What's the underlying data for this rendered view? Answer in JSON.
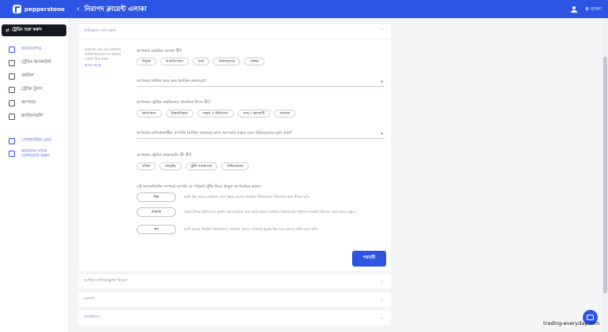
{
  "header": {
    "brand": "pepperstone",
    "back_icon": "chevron-left-icon",
    "title": "নিরাপদ ক্লায়েন্ট এলাকা",
    "language": "বাংলা"
  },
  "sidebar": {
    "start_trading": "ট্রেডিং শুরু করুন",
    "items": [
      {
        "label": "আবেদনপত্র",
        "icon": "document-icon",
        "active": true
      },
      {
        "label": "ট্রেডিং অ্যাকাউন্ট",
        "icon": "layers-icon"
      },
      {
        "label": "তহবিল",
        "icon": "wallet-icon"
      },
      {
        "label": "ট্রেডিং টুলস",
        "icon": "tools-icon"
      },
      {
        "label": "আপনার",
        "icon": "lock-icon"
      },
      {
        "label": "প্ল্যাটফর্মগুলি",
        "icon": "chart-icon"
      }
    ],
    "secondary": [
      {
        "label": "পেপারস্টোন হোম",
        "icon": "home-icon"
      },
      {
        "label": "আমাদের সাথে যোগাযোগ করুন",
        "icon": "phone-icon"
      }
    ]
  },
  "form": {
    "section_title": "অভিজ্ঞতা এবং জ্ঞান",
    "help_text": "আমাদের কেন এই তথ্যগুলি জানার প্রয়োজন তা জানতে এখানে ক্লিক করুন",
    "help_link": "আরও জানুন",
    "q_employment": "আপনার চাকরির অবস্থা কী?",
    "employment_options": [
      "নিযুক্ত",
      "স্ব-কর্মসংস্থান",
      "ছাত্র",
      "অবসরপ্রাপ্ত",
      "বেকার"
    ],
    "q_income": "আপনার বার্ষিক আয় কত (মার্কিন ডলারে)?",
    "q_funds_source": "আপনার ট্রেডিং তহবিলের প্রাথমিক উৎস কী?",
    "funds_options": [
      "কর্মসংস্থান",
      "উত্তরাধিকার",
      "সঞ্চয় ও বিনিয়োগ",
      "লাভ / রয়্যালটি",
      "অন্যান্য"
    ],
    "q_net_worth": "আপনার মালিকানাধীন সম্পত্তি (মার্কিন ডলারে) বাদে আপনার সঞ্চয় এবং বিনিয়োগের মূল্য কত?",
    "q_goals": "আপনার ট্রেডিং লক্ষ্যগুলি কী কী?",
    "goals_options": [
      "ফটকা",
      "ক্রমবৃদ্ধি",
      "ঝুঁকি ব্যবস্থাপনা",
      "বৈচিত্র্যকরণ"
    ],
    "q_risk": "এই অ্যাকাউন্টের সম্পর্কে আপনি যে পরিমাণ ঝুঁকি নিতে ইচ্ছুক তা নির্বাচন করুন।",
    "risk_options": [
      {
        "label": "উচ্চ",
        "text": "আমি উচ্চ মাত্রার অস্থিরতা এবং সম্ভাব্য আমার প্রাথমিক বিনিয়োগের পরিমাণের ক্ষতি স্বীকার করি।"
      },
      {
        "label": "মাঝারি",
        "text": "গড়ের উপরে রিটার্ন এবং মূলধন বৃদ্ধি অর্জনের জন্য আমি আমার প্রাথমিক বিনিয়োগের পরিমাণে মাঝারি পরিবর্তন গ্রহণ করতে প্রস্তুত।"
      },
      {
        "label": "কম",
        "text": "আমি আমার প্রাথমিক বিনিয়োগের পরিমাণে কোনও ওঠানামা ছাড়াই স্থির এবং ন্যূনতম রিটার্ন গ্রহণ করি।"
      }
    ],
    "next_button": "পরবর্তী"
  },
  "accordions": [
    {
      "title": "আর্থিক তালিকাভুক্তি বিবরণ"
    },
    {
      "title": "ঘোষণা"
    },
    {
      "title": "যাচাইকরণ"
    }
  ],
  "watermark": "trading-everyday.com",
  "colors": {
    "accent": "#2d54e3",
    "sidebar_button": "#151820"
  }
}
